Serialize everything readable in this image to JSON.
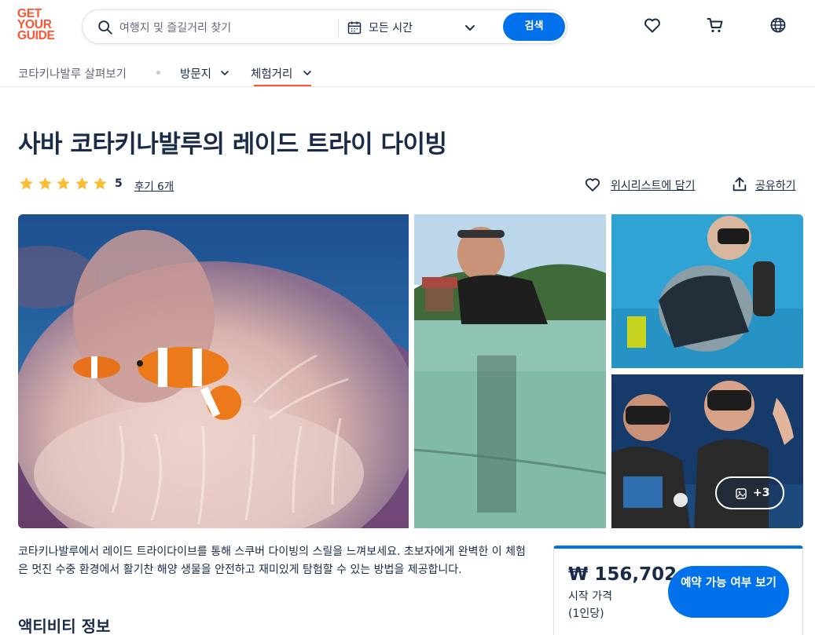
{
  "brand": {
    "logo_lines": [
      "GET",
      "YOUR",
      "GUIDE"
    ],
    "accent": "#ff5533",
    "primary": "#0071eb",
    "text": "#1a2b49"
  },
  "search": {
    "placeholder": "여행지 및 즐길거리 찾기",
    "date_value": "모든 시간",
    "button_label": "검색"
  },
  "header_icons": [
    "heart-icon",
    "cart-icon",
    "globe-icon"
  ],
  "nav": {
    "explore": "코타키나발루 살펴보기",
    "places": "방문지",
    "activities": "체험거리"
  },
  "activity": {
    "title": "사바 코타키나발루의 레이드 트라이 다이빙",
    "rating": "5",
    "rating_stars": 5,
    "reviews": "후기 6개",
    "wishlist_label": "위시리스트에 담기",
    "share_label": "공유하기",
    "more_photos": "+3",
    "description": "코타키나발루에서 레이드 트라이다이브를 통해 스쿠버 다이빙의 스릴을 느껴보세요. 초보자에게 완벽한 이 체험은 멋진 수중 환경에서 활기찬 해양 생물을 안전하고 재미있게 탐험할 수 있는 방법을 제공합니다.",
    "section_heading": "액티비티 정보"
  },
  "booking": {
    "price": "₩ 156,702",
    "from_label": "시작 가격",
    "per_person": "(1인당)",
    "cta_label": "예약 가능 여부 보기"
  }
}
